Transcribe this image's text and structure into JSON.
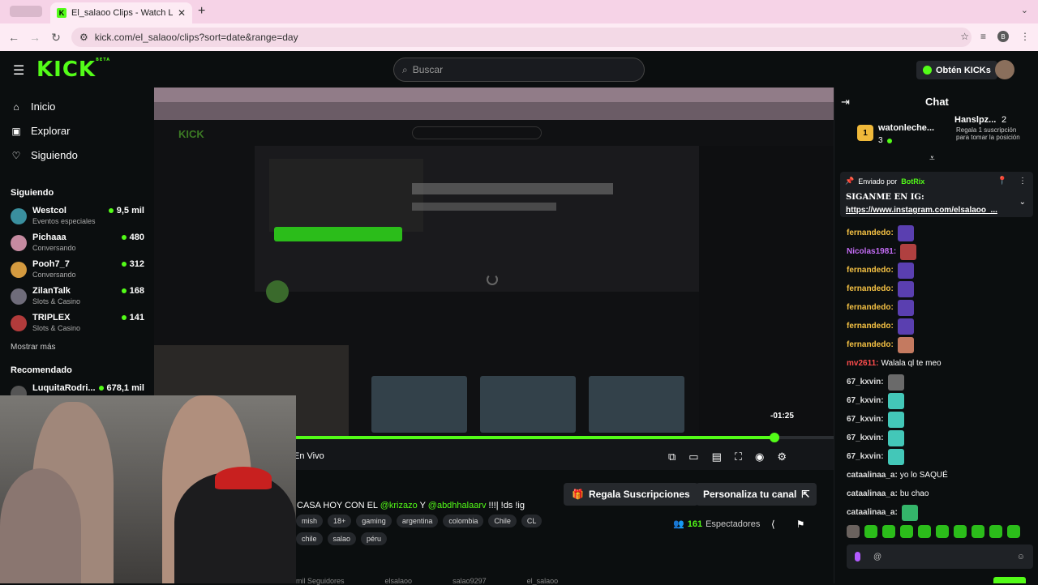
{
  "browser": {
    "tab_title": "El_salaoo Clips - Watch Live",
    "tab_close": "✕",
    "new_tab": "+",
    "url": "kick.com/el_salaoo/clips?sort=date&range=day",
    "profile_initial": "B"
  },
  "header": {
    "logo": "KICK",
    "logo_beta": "BETA",
    "search_placeholder": "Buscar",
    "kicks_label": "Obtén KICKs"
  },
  "sidebar": {
    "nav": [
      {
        "label": "Inicio",
        "icon": "home-icon"
      },
      {
        "label": "Explorar",
        "icon": "compass-icon"
      },
      {
        "label": "Siguiendo",
        "icon": "heart-icon"
      }
    ],
    "following_title": "Siguiendo",
    "following": [
      {
        "name": "Westcol",
        "category": "Eventos especiales",
        "viewers": "9,5 mil",
        "color": "#3a8f9e"
      },
      {
        "name": "Pichaaa",
        "category": "Conversando",
        "viewers": "480",
        "color": "#c58aa0"
      },
      {
        "name": "Pooh7_7",
        "category": "Conversando",
        "viewers": "312",
        "color": "#d49a3f"
      },
      {
        "name": "ZilanTalk",
        "category": "Slots & Casino",
        "viewers": "168",
        "color": "#6f6c7a"
      },
      {
        "name": "TRIPLEX",
        "category": "Slots & Casino",
        "viewers": "141",
        "color": "#b23b3b"
      }
    ],
    "show_more": "Mostrar más",
    "recommended_title": "Recomendado",
    "recommended": [
      {
        "name": "LuquitaRodri...",
        "viewers": "678,1 mil",
        "color": "#555"
      }
    ]
  },
  "player": {
    "time_remaining": "-01:25",
    "progress": 0.89,
    "live_label": "En Vivo",
    "controls": [
      "pip-icon",
      "theater-icon",
      "clip-icon",
      "fullscreen-icon",
      "autoplay-icon",
      "settings-icon"
    ]
  },
  "stream": {
    "title_prefix": "CASA HOY CON EL ",
    "mention1": "@krizazo",
    "title_mid": " Y ",
    "mention2": "@abdhhalaarv",
    "title_suffix": " !!!| !ds !ig",
    "tags_row1": [
      "mish",
      "18+",
      "gaming",
      "argentina",
      "colombia",
      "Chile",
      "CL"
    ],
    "tags_row2": [
      "chile",
      "salao",
      "péru"
    ],
    "gift_label": "Regala Suscripciones",
    "customize_label": "Personaliza tu canal",
    "viewers_count": "161",
    "viewers_label": "Espectadores",
    "bottom_text1": "mil Seguidores",
    "bottom_text2": "elsalaoo",
    "bottom_text3": "salao9297",
    "bottom_text4": "el_salaoo"
  },
  "chat": {
    "title": "Chat",
    "leaderboard": {
      "rank": "1",
      "name": "watonleche...",
      "count": "3",
      "second_name": "Hanslpz...",
      "second_count": "2",
      "second_desc": "Regala 1 suscripción para tomar la posición"
    },
    "pinned": {
      "sent_by": "Enviado por",
      "bot": "BotRix",
      "text": "SIGANME EN IG:",
      "link": "https://www.instagram.com/elsalaoo_..."
    },
    "messages": [
      {
        "user": "fernandedo:",
        "text": "",
        "color": "#f6c244",
        "emote": "#5a3fb0"
      },
      {
        "user": "Nicolas1981:",
        "text": "",
        "color": "#c46cf5",
        "emote": "#b04040"
      },
      {
        "user": "fernandedo:",
        "text": "",
        "color": "#f6c244",
        "emote": "#5a3fb0"
      },
      {
        "user": "fernandedo:",
        "text": "",
        "color": "#f6c244",
        "emote": "#5a3fb0"
      },
      {
        "user": "fernandedo:",
        "text": "",
        "color": "#f6c244",
        "emote": "#5a3fb0"
      },
      {
        "user": "fernandedo:",
        "text": "",
        "color": "#f6c244",
        "emote": "#5a3fb0"
      },
      {
        "user": "fernandedo:",
        "text": "",
        "color": "#f6c244",
        "emote": "#c47a60"
      },
      {
        "user": "mv2611:",
        "text": "Walala ql te meo",
        "color": "#ff4d4d",
        "emote": ""
      },
      {
        "user": "67_kxvin:",
        "text": "",
        "color": "#dddddd",
        "emote": "#6a6a6a"
      },
      {
        "user": "67_kxvin:",
        "text": "",
        "color": "#dddddd",
        "emote": "#43c7b8"
      },
      {
        "user": "67_kxvin:",
        "text": "",
        "color": "#dddddd",
        "emote": "#43c7b8"
      },
      {
        "user": "67_kxvin:",
        "text": "",
        "color": "#dddddd",
        "emote": "#43c7b8"
      },
      {
        "user": "67_kxvin:",
        "text": "",
        "color": "#dddddd",
        "emote": "#43c7b8"
      },
      {
        "user": "cataalinaa_a:",
        "text": "yo lo SAQUÉ",
        "color": "#dddddd",
        "emote": ""
      },
      {
        "user": "cataalinaa_a:",
        "text": "bu chao",
        "color": "#dddddd",
        "emote": ""
      },
      {
        "user": "cataalinaa_a:",
        "text": "",
        "color": "#dddddd",
        "emote": "#34b56a"
      }
    ],
    "input_placeholder": "@",
    "accent": "#53fc18"
  }
}
